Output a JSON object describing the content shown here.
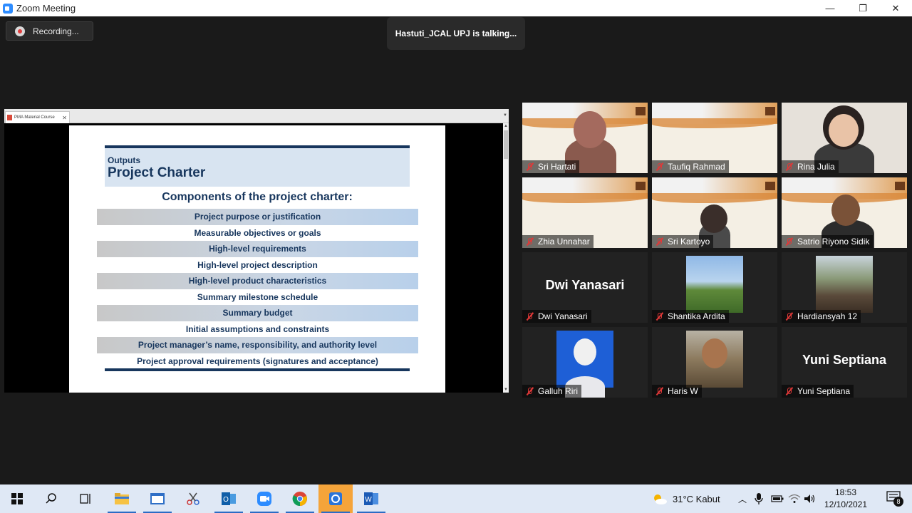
{
  "window": {
    "title": "Zoom Meeting"
  },
  "recording": {
    "label": "Recording..."
  },
  "talking": {
    "text": "Hastuti_JCAL UPJ is talking..."
  },
  "share": {
    "tab_label": "PMA Material Course",
    "slide": {
      "outputs": "Outputs",
      "title": "Project Charter",
      "subtitle": "Components of the project charter:",
      "rows": [
        "Project purpose or justification",
        "Measurable objectives or goals",
        "High-level requirements",
        "High-level project description",
        "High-level product characteristics",
        "Summary milestone schedule",
        "Summary budget",
        "Initial assumptions and constraints",
        "Project manager’s name, responsibility, and authority level",
        "Project approval requirements (signatures and acceptance)"
      ]
    }
  },
  "participants": [
    {
      "name": "Sri Hartati"
    },
    {
      "name": "Taufiq Rahmad"
    },
    {
      "name": "Rina Julia"
    },
    {
      "name": "Zhia Unnahar"
    },
    {
      "name": "Sri Kartoyo"
    },
    {
      "name": "Satrio Riyono Sidik"
    },
    {
      "name": "Dwi Yanasari",
      "display": "Dwi Yanasari"
    },
    {
      "name": "Shantika Ardita"
    },
    {
      "name": "Hardiansyah 12"
    },
    {
      "name": "Galluh Riri"
    },
    {
      "name": "Haris W"
    },
    {
      "name": "Yuni Septiana",
      "display": "Yuni Septiana"
    }
  ],
  "taskbar": {
    "weather": "31°C  Kabut",
    "time": "18:53",
    "date": "12/10/2021",
    "notifications": "8"
  }
}
